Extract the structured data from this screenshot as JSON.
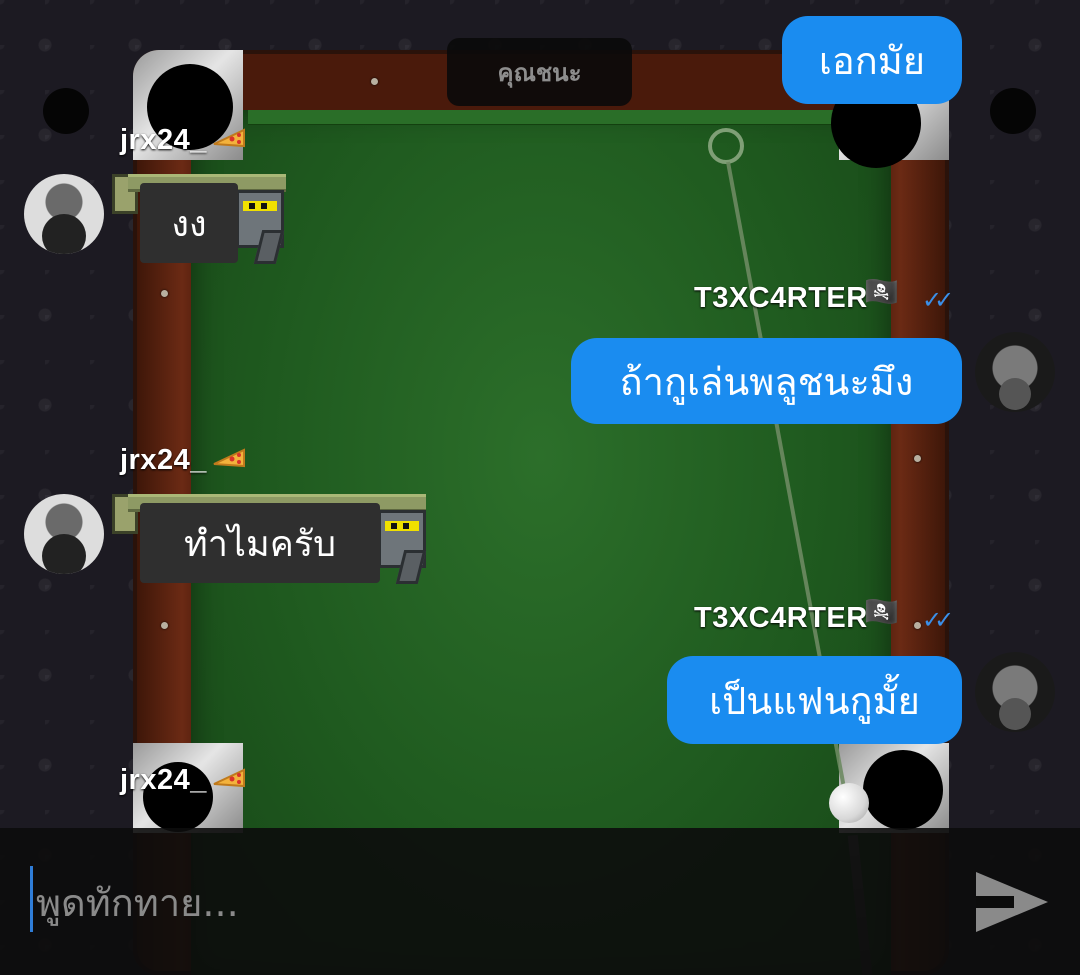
{
  "game": {
    "status_label": "คุณชนะ"
  },
  "messages": [
    {
      "sender": "T3XC4RTER",
      "side": "right",
      "text": "เอกมัย"
    },
    {
      "sender": "jrx24_",
      "side": "left",
      "text": "งง"
    },
    {
      "sender": "T3XC4RTER",
      "side": "right",
      "text": "ถ้ากูเล่นพลูชนะมึง"
    },
    {
      "sender": "jrx24_",
      "side": "left",
      "text": "ทำไมครับ"
    },
    {
      "sender": "T3XC4RTER",
      "side": "right",
      "text": "เป็นแฟนกูมั้ย"
    },
    {
      "sender": "jrx24_",
      "side": "left",
      "text": ""
    }
  ],
  "names": {
    "left_user": "jrx24_",
    "right_user": "T3XC4RTER",
    "left_badge": "pizza-icon",
    "right_badge": "pirate-flag-icon"
  },
  "colors": {
    "outgoing_bubble": "#1a8cf0",
    "incoming_bubble": "#2f2f2f",
    "read_ticks": "#3a8fe8"
  },
  "composer": {
    "placeholder": "พูดทักทาย..."
  }
}
